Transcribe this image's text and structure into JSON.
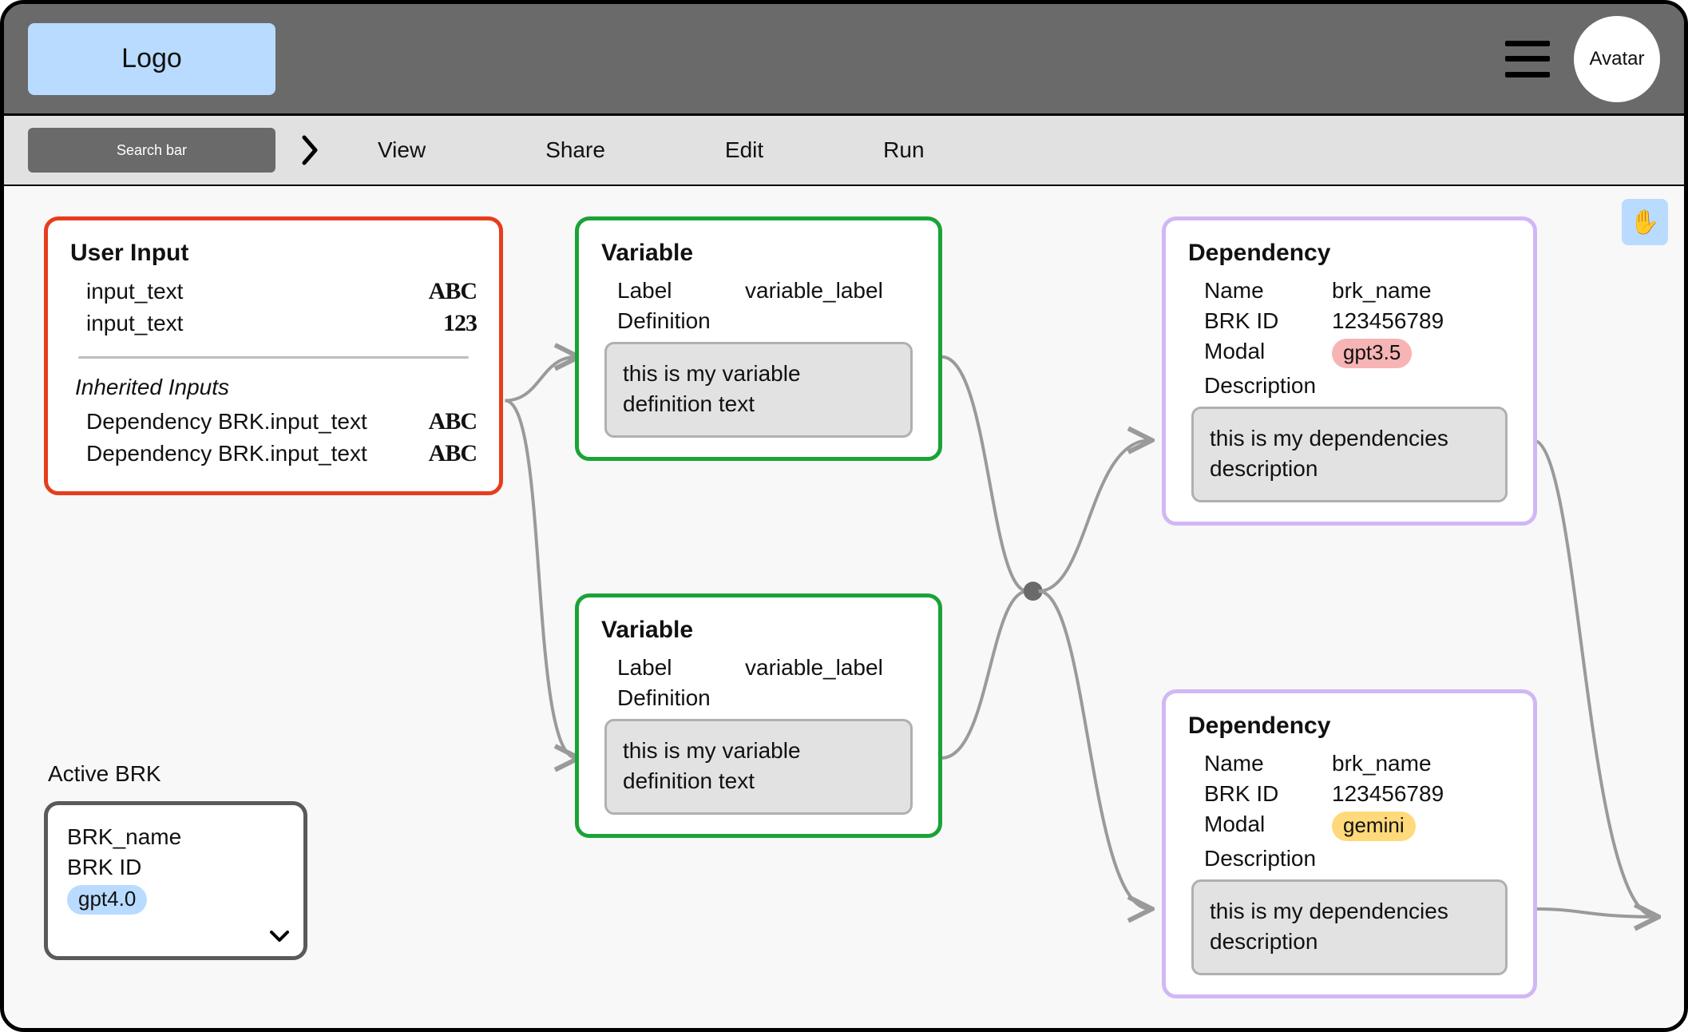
{
  "header": {
    "logo_text": "Logo",
    "avatar_text": "Avatar"
  },
  "toolbar": {
    "search_placeholder": "Search bar",
    "menu": {
      "view": "View",
      "share": "Share",
      "edit": "Edit",
      "run": "Run"
    }
  },
  "user_input": {
    "title": "User Input",
    "inputs": [
      {
        "label": "input_text",
        "type_glyph": "ABC"
      },
      {
        "label": "input_text",
        "type_glyph": "123"
      }
    ],
    "inherited_heading": "Inherited Inputs",
    "inherited": [
      {
        "label": "Dependency BRK.input_text",
        "type_glyph": "ABC"
      },
      {
        "label": "Dependency BRK.input_text",
        "type_glyph": "ABC"
      }
    ]
  },
  "variables": [
    {
      "title": "Variable",
      "label_key": "Label",
      "label_value": "variable_label",
      "definition_key": "Definition",
      "definition_text": "this is my variable definition text"
    },
    {
      "title": "Variable",
      "label_key": "Label",
      "label_value": "variable_label",
      "definition_key": "Definition",
      "definition_text": "this is my variable definition text"
    }
  ],
  "dependencies": [
    {
      "title": "Dependency",
      "name_key": "Name",
      "name_value": "brk_name",
      "id_key": "BRK ID",
      "id_value": "123456789",
      "modal_key": "Modal",
      "modal_value": "gpt3.5",
      "modal_color": "red",
      "description_key": "Description",
      "description_text": "this is my dependencies description"
    },
    {
      "title": "Dependency",
      "name_key": "Name",
      "name_value": "brk_name",
      "id_key": "BRK ID",
      "id_value": "123456789",
      "modal_key": "Modal",
      "modal_value": "gemini",
      "modal_color": "yellow",
      "description_key": "Description",
      "description_text": "this is my dependencies description"
    }
  ],
  "active_brk": {
    "heading": "Active BRK",
    "name": "BRK_name",
    "id_label": "BRK ID",
    "modal_value": "gpt4.0"
  },
  "tool": {
    "hand_glyph": "✋"
  }
}
